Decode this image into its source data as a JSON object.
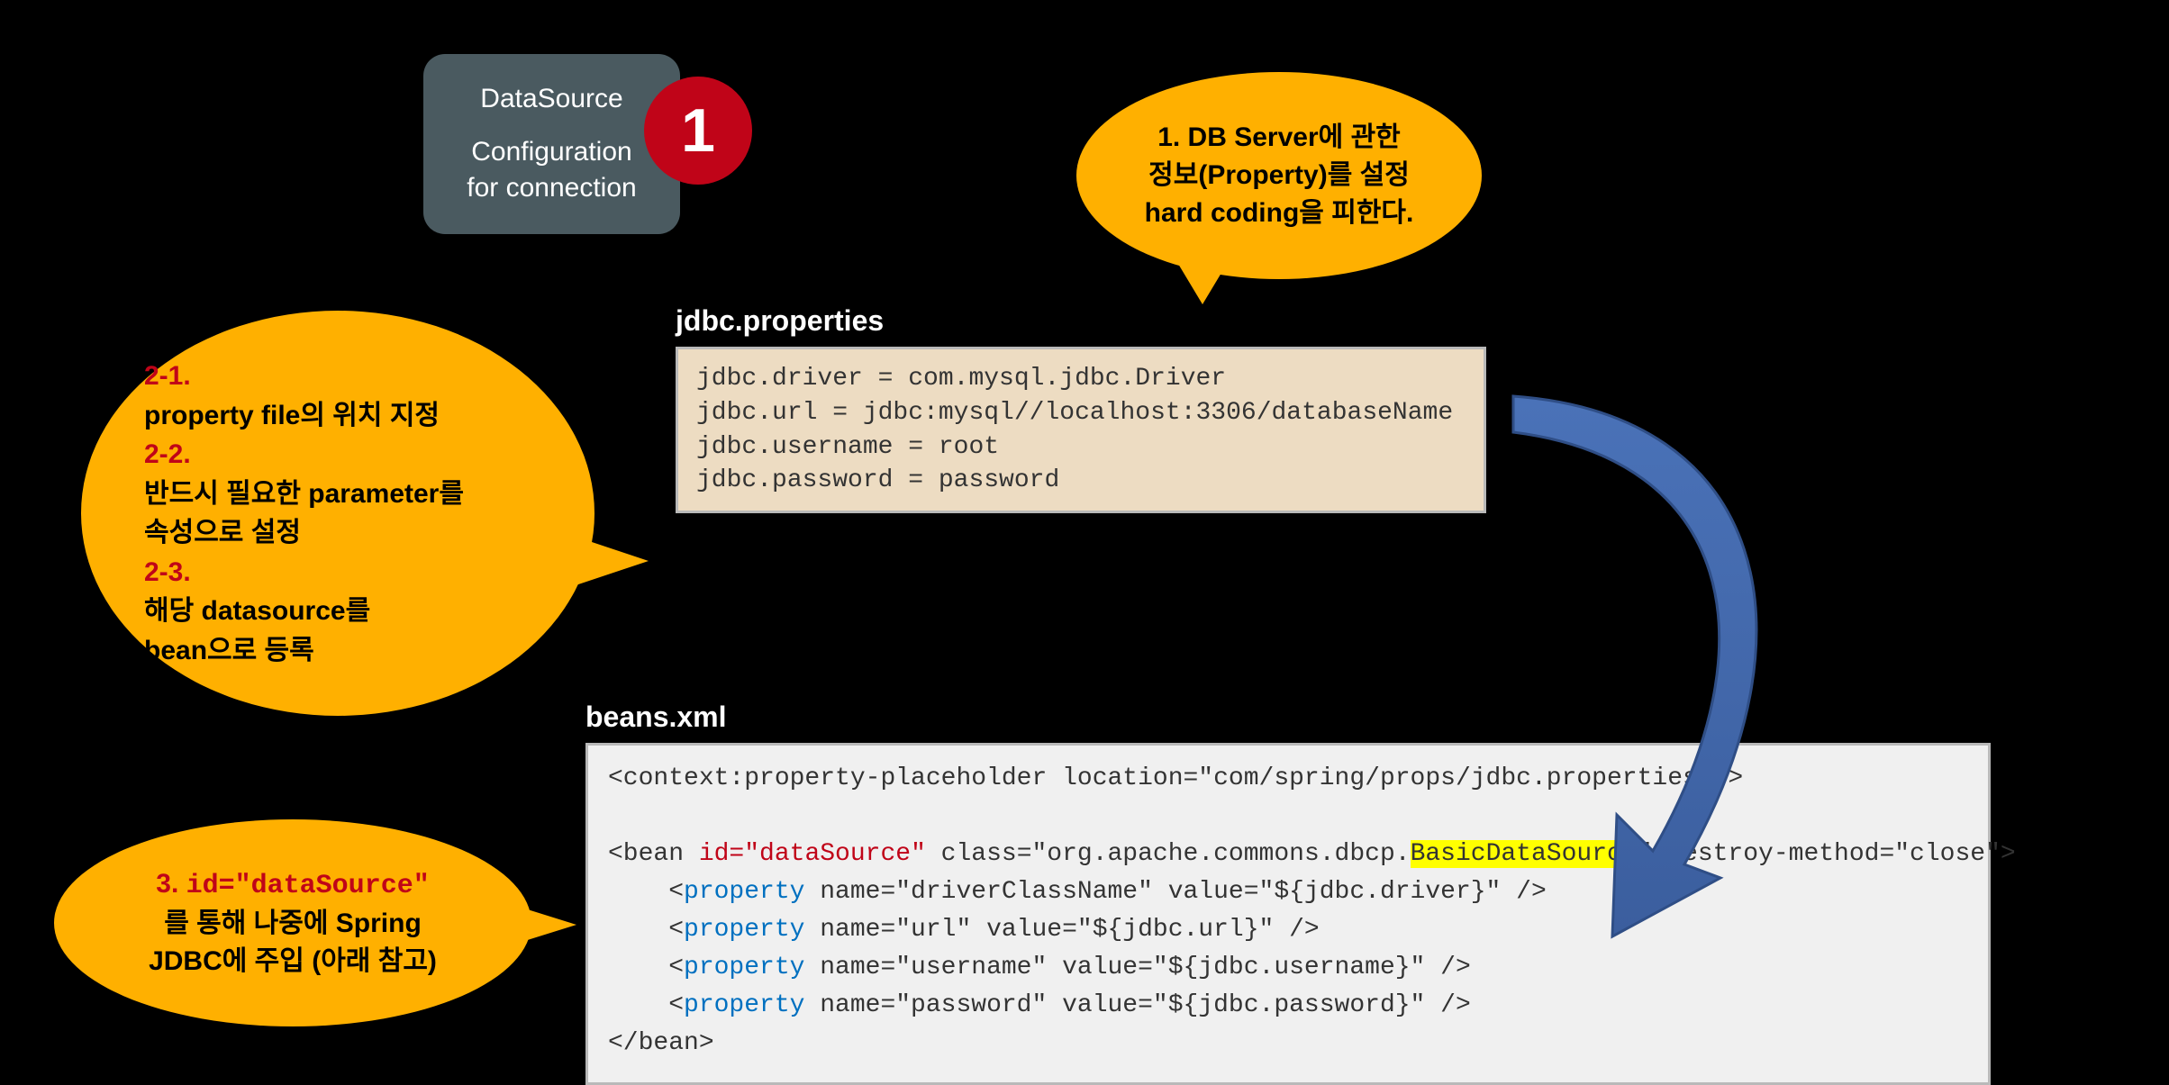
{
  "dsBox": {
    "line1": "DataSource",
    "line2": "Configuration",
    "line3": "for connection"
  },
  "badge": "1",
  "callout1": {
    "line1": "1. DB Server에 관한",
    "line2": "정보(Property)를 설정",
    "line3": "hard coding을 피한다."
  },
  "callout2": {
    "h1": "2-1.",
    "l1": "property file의 위치 지정",
    "h2": "2-2.",
    "l2a": "반드시 필요한 parameter를",
    "l2b": "속성으로 설정",
    "h3": "2-3.",
    "l3a": "해당 datasource를",
    "l3b": "bean으로 등록"
  },
  "callout3": {
    "prefix": "3. ",
    "code": "id=\"dataSource\"",
    "l2": "를 통해 나중에 Spring",
    "l3": "JDBC에 주입 (아래 참고)"
  },
  "titles": {
    "props": "jdbc.properties",
    "beans": "beans.xml"
  },
  "propsCode": "jdbc.driver = com.mysql.jdbc.Driver\njdbc.url = jdbc:mysql//localhost:3306/databaseName\njdbc.username = root\njdbc.password = password",
  "beansCode": {
    "l1a": "<context:property-placeholder location=\"com/spring/props/jdbc.properties\"/>",
    "blank": "",
    "l2a": "<bean ",
    "l2b": "id=\"dataSource\"",
    "l2c": " class=\"org.apache.commons.dbcp.",
    "l2d": "BasicDataSource",
    "l2e": "\" destroy-method=\"close\">",
    "l3a": "    <",
    "prop": "property",
    "l3b": " name=\"driverClassName\" value=\"${jdbc.driver}\" />",
    "l4b": " name=\"url\" value=\"${jdbc.url}\" />",
    "l5b": " name=\"username\" value=\"${jdbc.username}\" />",
    "l6b": " name=\"password\" value=\"${jdbc.password}\" />",
    "l7": "</bean>"
  }
}
